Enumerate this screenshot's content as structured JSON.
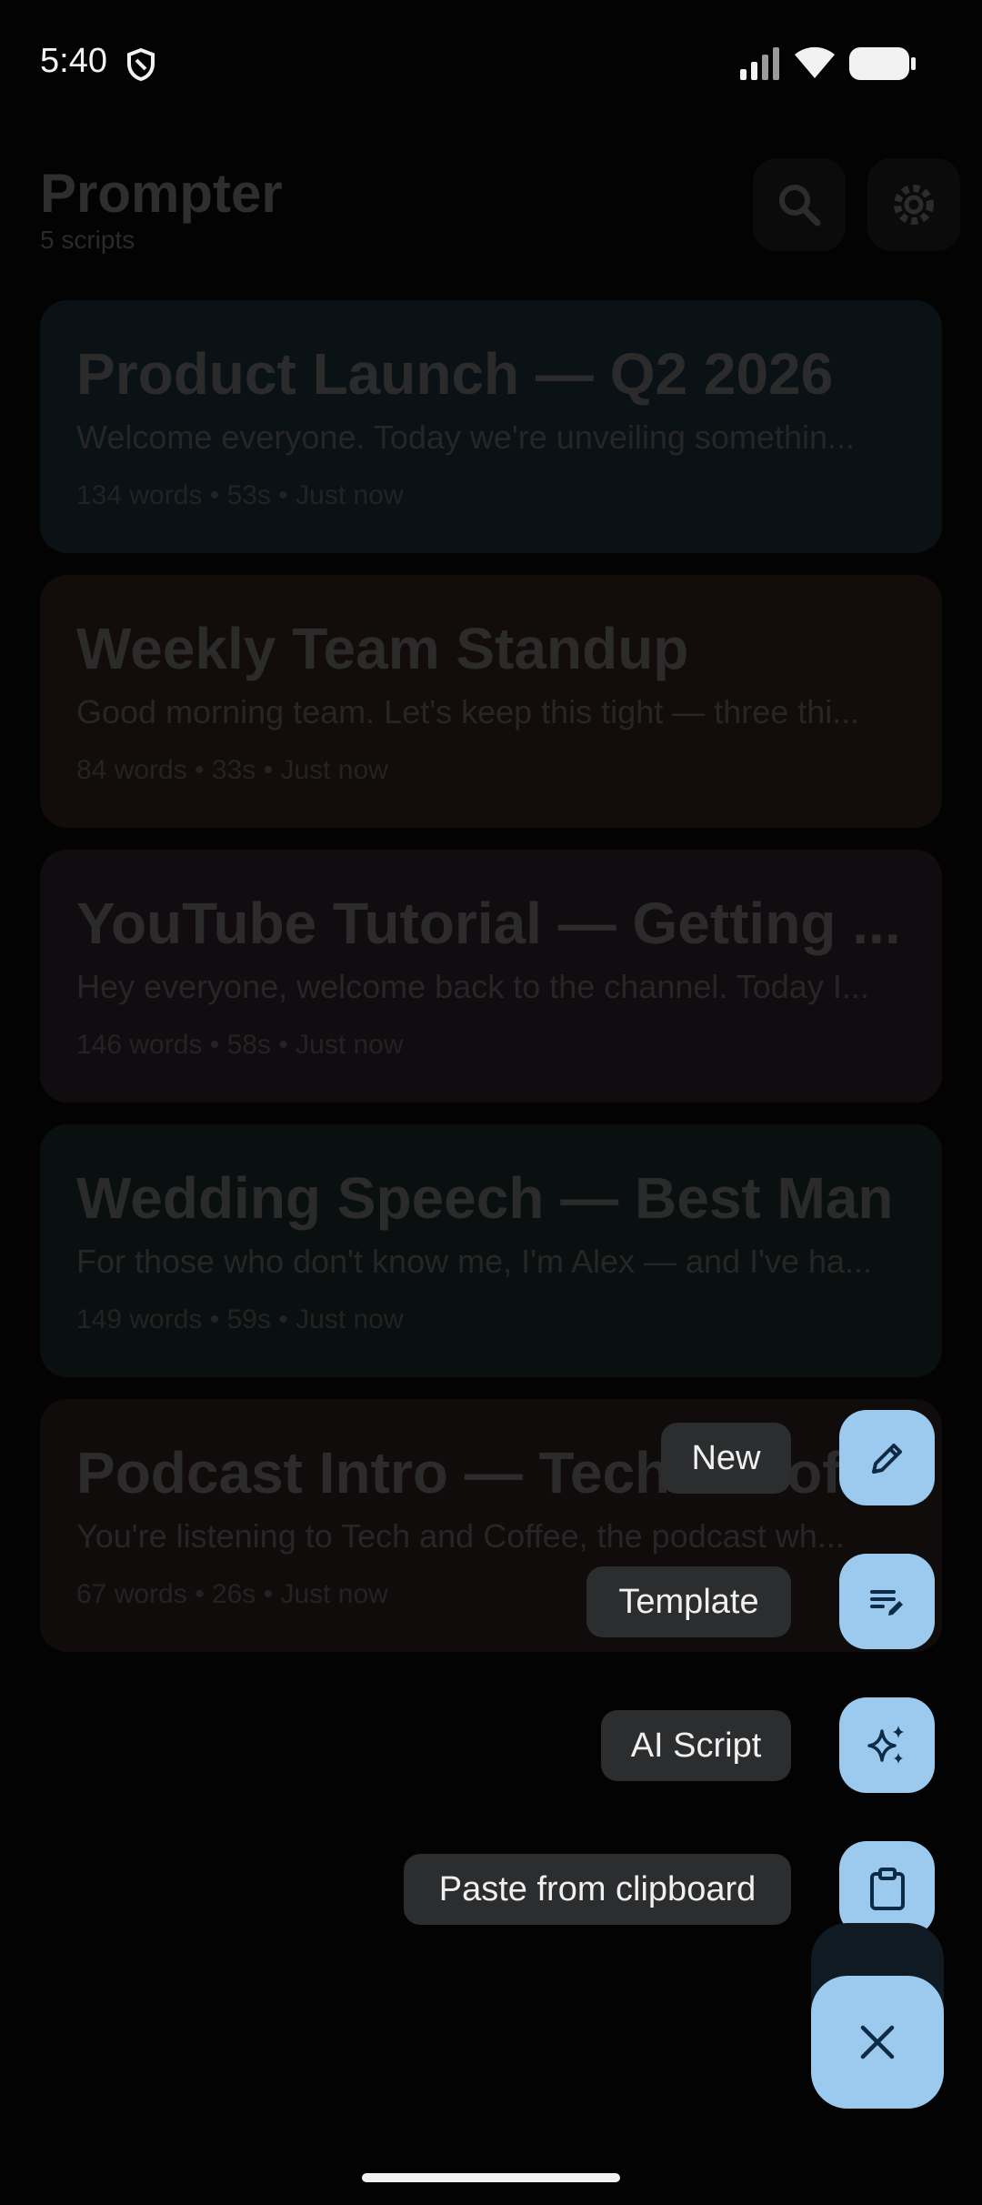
{
  "status_bar": {
    "time": "5:40"
  },
  "header": {
    "title": "Prompter",
    "subtitle": "5 scripts"
  },
  "scripts": [
    {
      "title": "Product Launch — Q2 2026",
      "preview": "Welcome everyone. Today we're unveiling somethin...",
      "meta": "134 words • 53s • Just now",
      "color": "#0a1216"
    },
    {
      "title": "Weekly Team Standup",
      "preview": "Good morning team. Let's keep this tight — three thi...",
      "meta": "84 words • 33s • Just now",
      "color": "#120d0a"
    },
    {
      "title": "YouTube Tutorial — Getting ...",
      "preview": "Hey everyone, welcome back to the channel. Today I...",
      "meta": "146 words • 58s • Just now",
      "color": "#110c10"
    },
    {
      "title": "Wedding Speech — Best Man",
      "preview": "For those who don't know me, I'm Alex — and I've ha...",
      "meta": "149 words • 59s • Just now",
      "color": "#0a0f10"
    },
    {
      "title": "Podcast Intro — Tech & Coffee",
      "preview": "You're listening to Tech and Coffee, the podcast wh...",
      "meta": "67 words • 26s • Just now",
      "color": "#110c0c"
    }
  ],
  "speed_dial": {
    "new_label": "New",
    "template_label": "Template",
    "ai_label": "AI Script",
    "paste_label": "Paste from clipboard"
  },
  "icons": {
    "new": "pencil-icon",
    "template": "template-icon",
    "ai": "sparkle-icon",
    "paste": "clipboard-icon",
    "close": "close-icon"
  },
  "colors": {
    "fab": "#9ccaee",
    "fab_icon": "#0d2b44",
    "chip": "#2c2d2e"
  }
}
